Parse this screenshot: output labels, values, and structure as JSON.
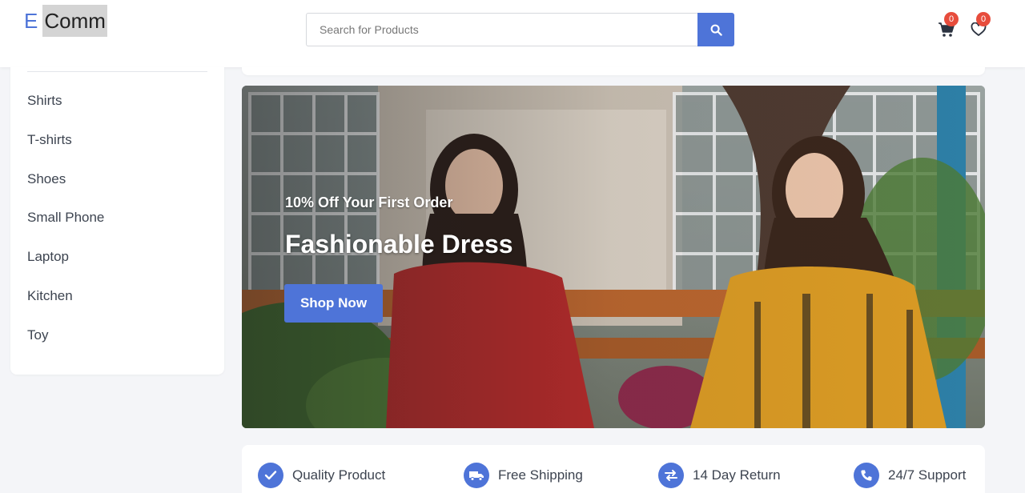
{
  "header": {
    "logo_prefix": "E",
    "logo_main": "Comm",
    "search_placeholder": "Search for Products",
    "cart_count": "0",
    "wishlist_count": "0"
  },
  "sidebar": {
    "items": [
      {
        "label": "Shirts"
      },
      {
        "label": "T-shirts"
      },
      {
        "label": "Shoes"
      },
      {
        "label": "Small Phone"
      },
      {
        "label": "Laptop"
      },
      {
        "label": "Kitchen"
      },
      {
        "label": "Toy"
      }
    ]
  },
  "banner": {
    "promo": "10% Off Your First Order",
    "title": "Fashionable Dress",
    "cta": "Shop Now"
  },
  "features": [
    {
      "label": "Quality Product",
      "icon": "check-icon"
    },
    {
      "label": "Free Shipping",
      "icon": "truck-icon"
    },
    {
      "label": "14 Day Return",
      "icon": "exchange-icon"
    },
    {
      "label": "24/7 Support",
      "icon": "phone-icon"
    }
  ],
  "colors": {
    "accent": "#4e74d8",
    "badge": "#e74c3c"
  }
}
